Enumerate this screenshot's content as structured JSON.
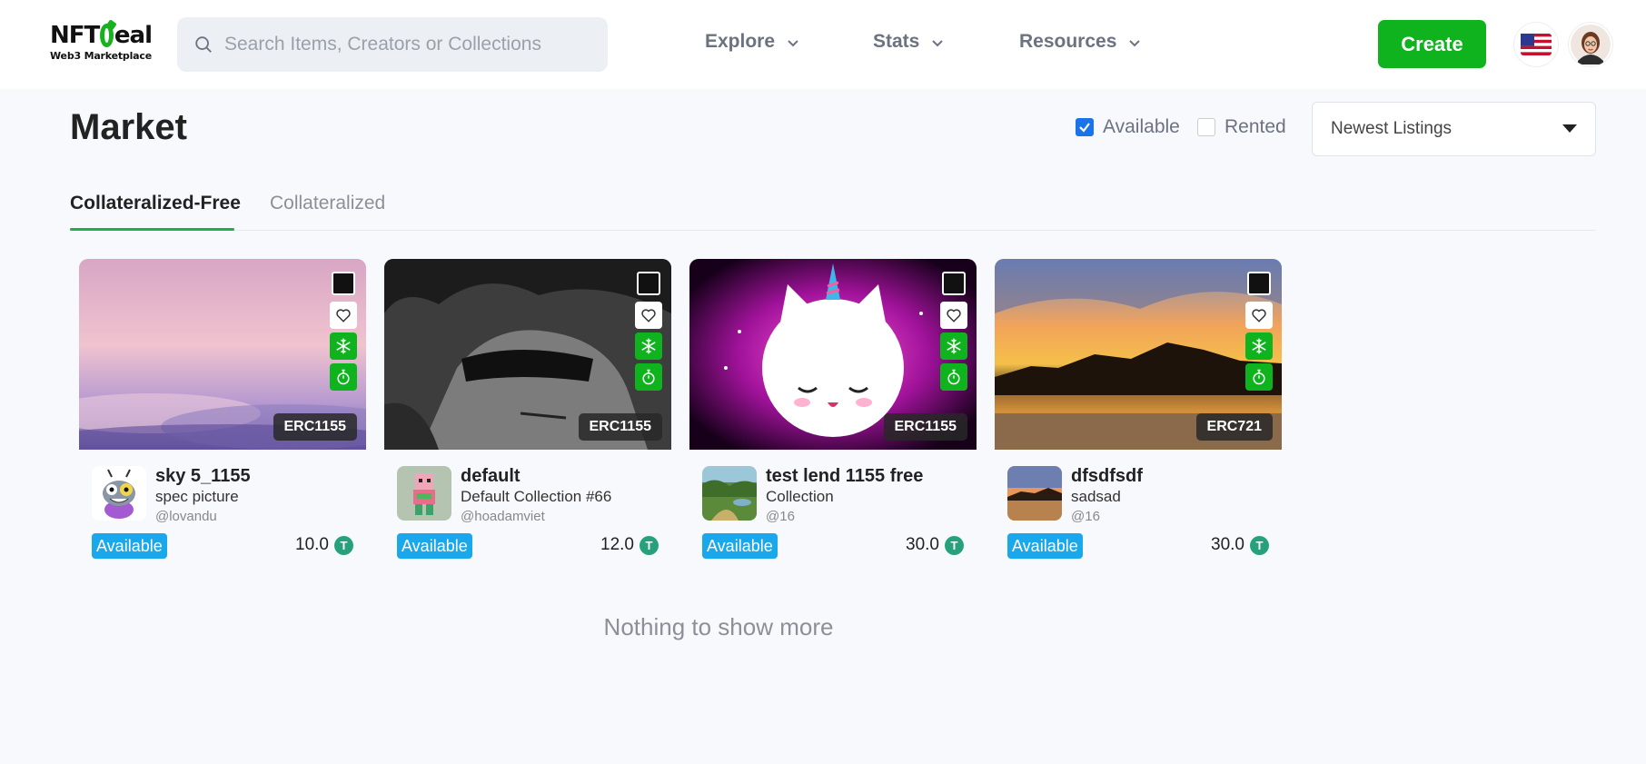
{
  "header": {
    "logo_text_left": "NFT",
    "logo_text_right": "eal",
    "logo_subtitle": "Web3 Marketplace",
    "search_placeholder": "Search Items, Creators or Collections",
    "nav": [
      {
        "label": "Explore"
      },
      {
        "label": "Stats"
      },
      {
        "label": "Resources"
      }
    ],
    "create_label": "Create"
  },
  "page": {
    "title": "Market",
    "filters": {
      "available_label": "Available",
      "available_checked": true,
      "rented_label": "Rented",
      "rented_checked": false
    },
    "sort_selected": "Newest Listings",
    "tabs": [
      {
        "label": "Collateralized-Free",
        "active": true
      },
      {
        "label": "Collateralized",
        "active": false
      }
    ]
  },
  "cards": [
    {
      "standard": "ERC1155",
      "name": "sky 5_1155",
      "collection": "spec picture",
      "owner": "@lovandu",
      "status": "Available",
      "price": "10.0",
      "currency_icon": "tether-icon"
    },
    {
      "standard": "ERC1155",
      "name": "default",
      "collection": "Default Collection #66",
      "owner": "@hoadamviet",
      "status": "Available",
      "price": "12.0",
      "currency_icon": "tether-icon"
    },
    {
      "standard": "ERC1155",
      "name": "test lend 1155 free",
      "collection": "Collection",
      "owner": "@16",
      "status": "Available",
      "price": "30.0",
      "currency_icon": "tether-icon"
    },
    {
      "standard": "ERC721",
      "name": "dfsdfsdf",
      "collection": "sadsad",
      "owner": "@16",
      "status": "Available",
      "price": "30.0",
      "currency_icon": "tether-icon"
    }
  ],
  "footer_message": "Nothing to show more",
  "colors": {
    "accent_green": "#0fb31d",
    "status_blue": "#1aa7ec",
    "tether_green": "#26a17b",
    "tab_underline": "#1db04a"
  }
}
